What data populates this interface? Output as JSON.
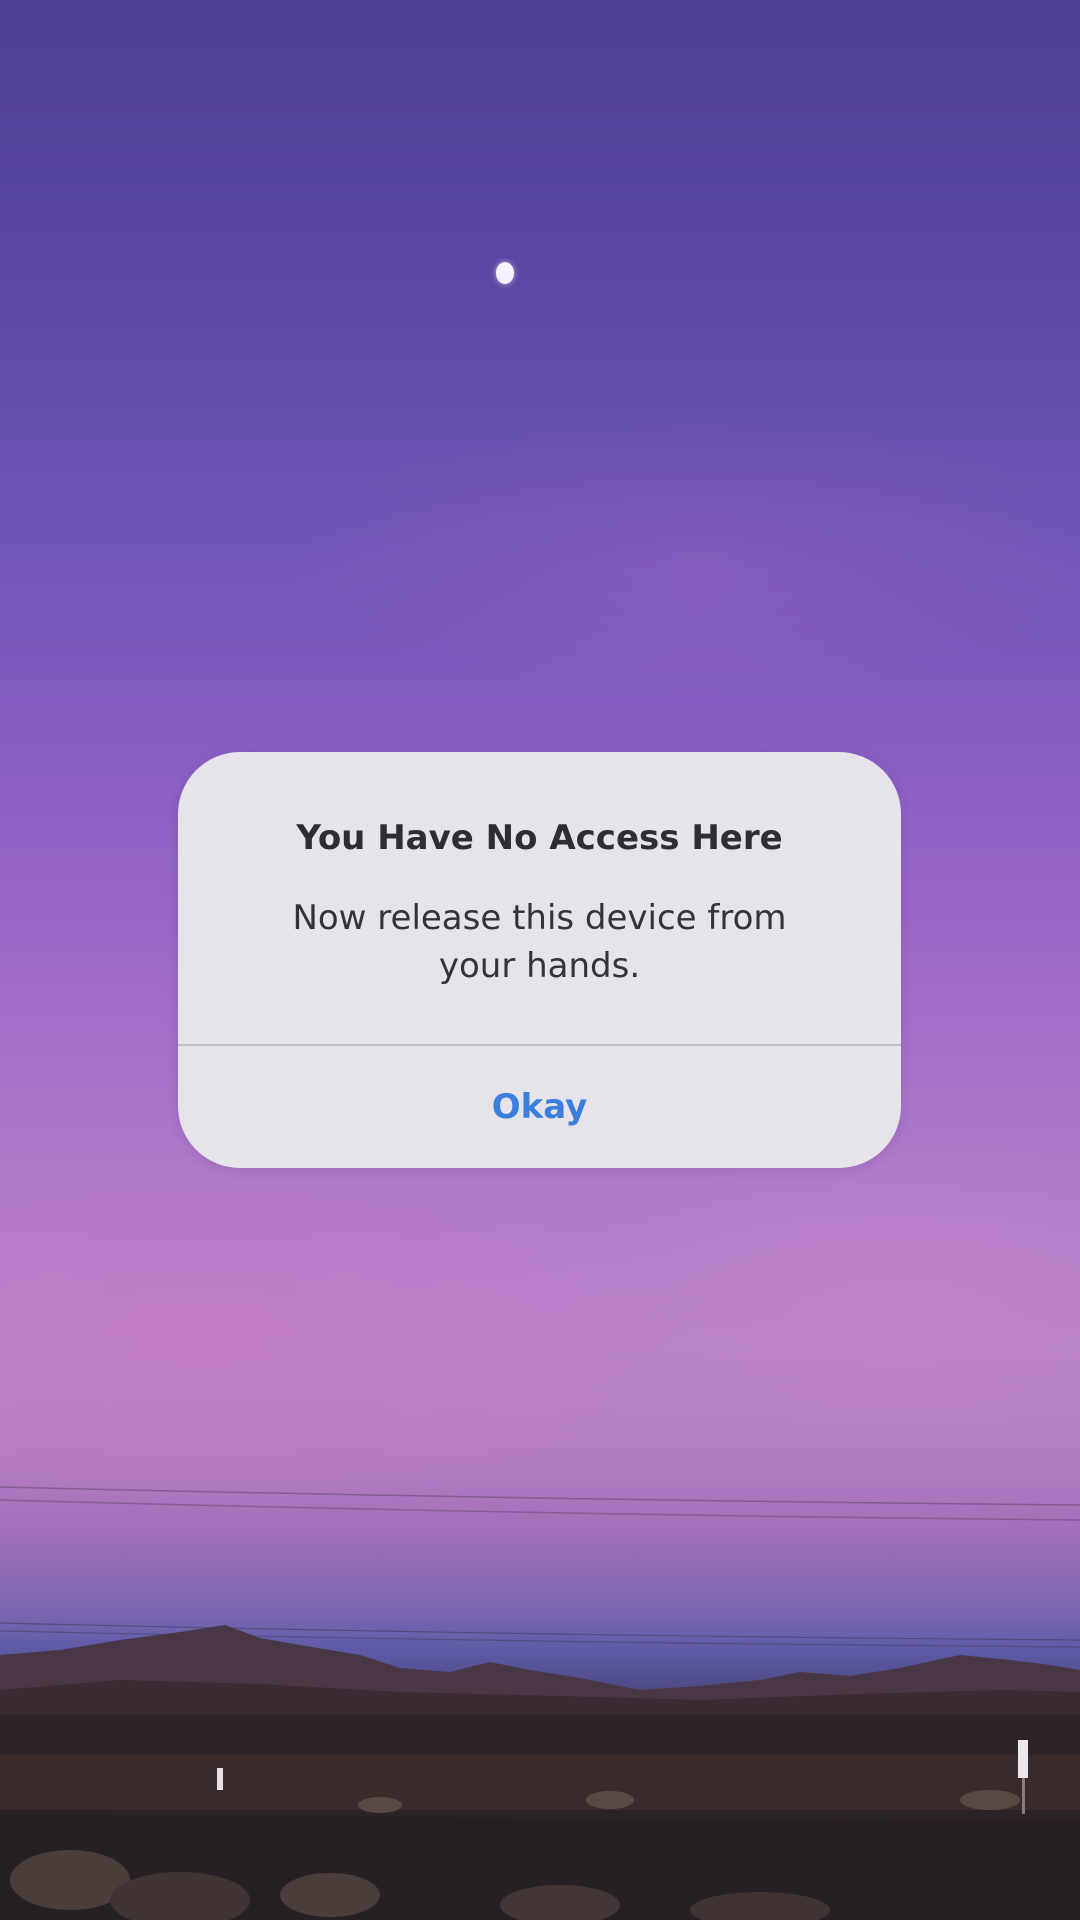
{
  "dialog": {
    "title": "You Have No Access Here",
    "message": "Now release this device from your hands.",
    "button_label": "Okay",
    "button_color": "#3b7ede",
    "background_color": "#e6e3ea"
  },
  "wallpaper": {
    "description_colors": [
      "#4f3f95",
      "#8a5fc4",
      "#b983cb",
      "#241c1f"
    ]
  }
}
